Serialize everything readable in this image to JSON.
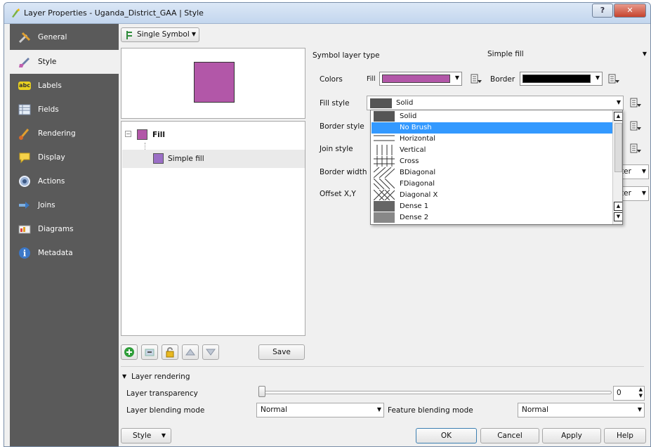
{
  "window": {
    "title": "Layer Properties - Uganda_District_GAA | Style"
  },
  "sidebar": {
    "items": [
      {
        "label": "General"
      },
      {
        "label": "Style"
      },
      {
        "label": "Labels"
      },
      {
        "label": "Fields"
      },
      {
        "label": "Rendering"
      },
      {
        "label": "Display"
      },
      {
        "label": "Actions"
      },
      {
        "label": "Joins"
      },
      {
        "label": "Diagrams"
      },
      {
        "label": "Metadata"
      }
    ]
  },
  "renderer": {
    "type": "Single Symbol"
  },
  "symbol_tree": {
    "root": "Fill",
    "child": "Simple fill"
  },
  "symbol_panel": {
    "layer_type_label": "Symbol layer type",
    "layer_type_value": "Simple fill",
    "colors_label": "Colors",
    "fill_label": "Fill",
    "fill_color": "#b257a8",
    "border_label": "Border",
    "border_color": "#000000",
    "fill_style_label": "Fill style",
    "fill_style_value": "Solid",
    "border_style_label": "Border style",
    "join_style_label": "Join style",
    "border_width_label": "Border width",
    "offset_label": "Offset X,Y",
    "unit_partial": "ter"
  },
  "fill_style_options": [
    "Solid",
    "No Brush",
    "Horizontal",
    "Vertical",
    "Cross",
    "BDiagonal",
    "FDiagonal",
    "Diagonal X",
    "Dense 1",
    "Dense 2"
  ],
  "fill_style_selected": "No Brush",
  "actions": {
    "save_label": "Save"
  },
  "layer_rendering": {
    "header": "Layer rendering",
    "transparency_label": "Layer transparency",
    "transparency_value": "0",
    "blending_label": "Layer blending mode",
    "blending_value": "Normal",
    "feature_blending_label": "Feature blending mode",
    "feature_blending_value": "Normal"
  },
  "footer": {
    "style_label": "Style",
    "ok_label": "OK",
    "cancel_label": "Cancel",
    "apply_label": "Apply",
    "help_label": "Help"
  },
  "colors": {
    "accent": "#3399ff",
    "sidebar_bg": "#5a5a5a",
    "fill_swatch": "#b257a8",
    "tree_swatch": "#9b6fc6"
  }
}
